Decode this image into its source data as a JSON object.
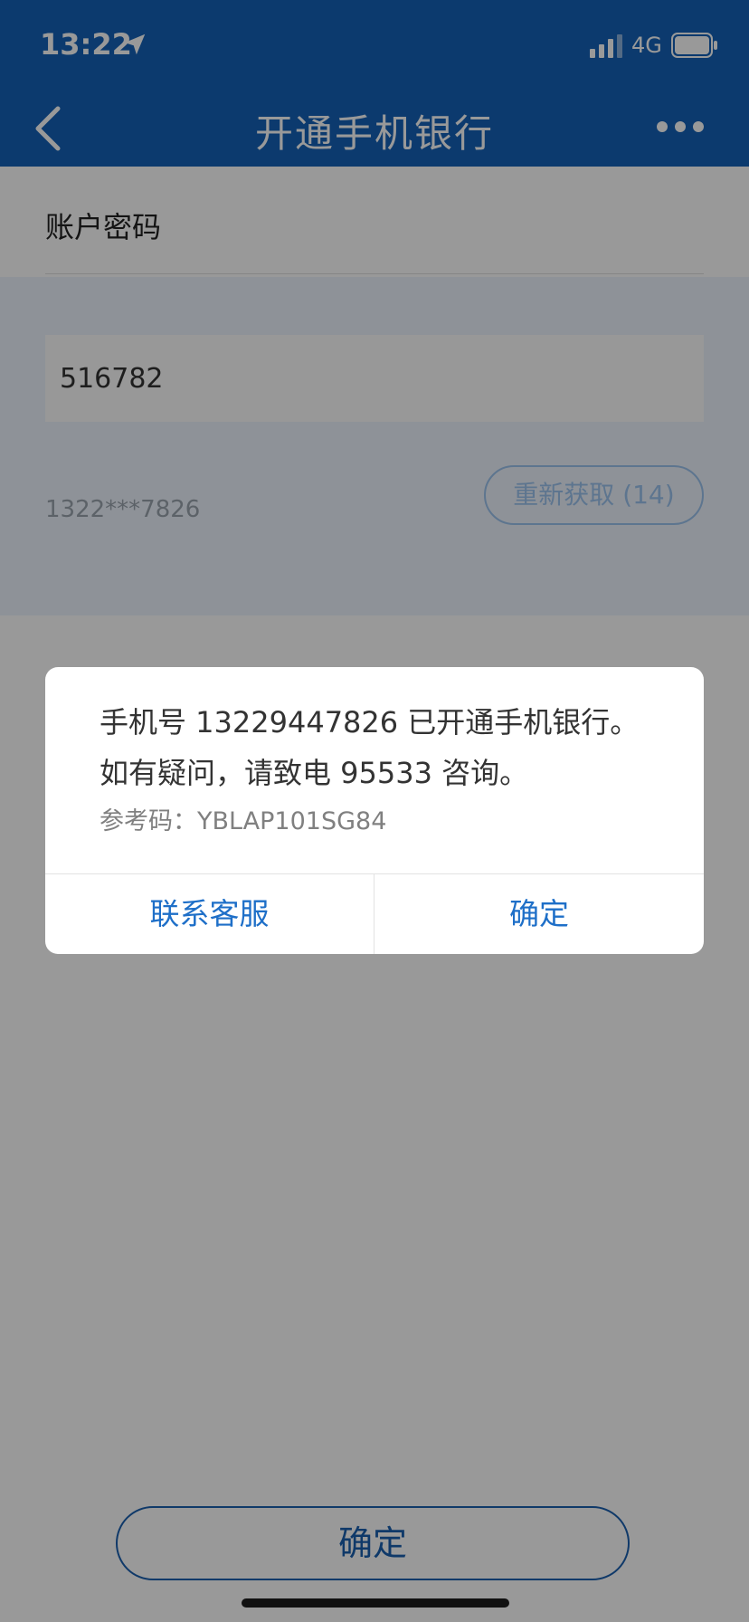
{
  "status_bar": {
    "time": "13:22",
    "network": "4G",
    "icons": [
      "location-arrow-icon",
      "signal-icon",
      "battery-icon"
    ]
  },
  "nav": {
    "title": "开通手机银行",
    "back_icon": "chevron-left-icon",
    "more_icon": "more-dots-icon"
  },
  "form": {
    "password_label": "账户密码",
    "sms_code_value": "516782",
    "phone_masked": "1322***7826",
    "resend_label": "重新获取 (14)"
  },
  "main_confirm_label": "确定",
  "dialog": {
    "line1": "手机号 13229447826 已开通手机银行。",
    "line2": "如有疑问，请致电 95533 咨询。",
    "reference": "参考码：YBLAP101SG84",
    "contact_button": "联系客服",
    "ok_button": "确定"
  },
  "colors": {
    "header_blue": "#1462b8",
    "accent_blue": "#1e6fc8",
    "overlay": "rgba(0,0,0,0.4)"
  }
}
